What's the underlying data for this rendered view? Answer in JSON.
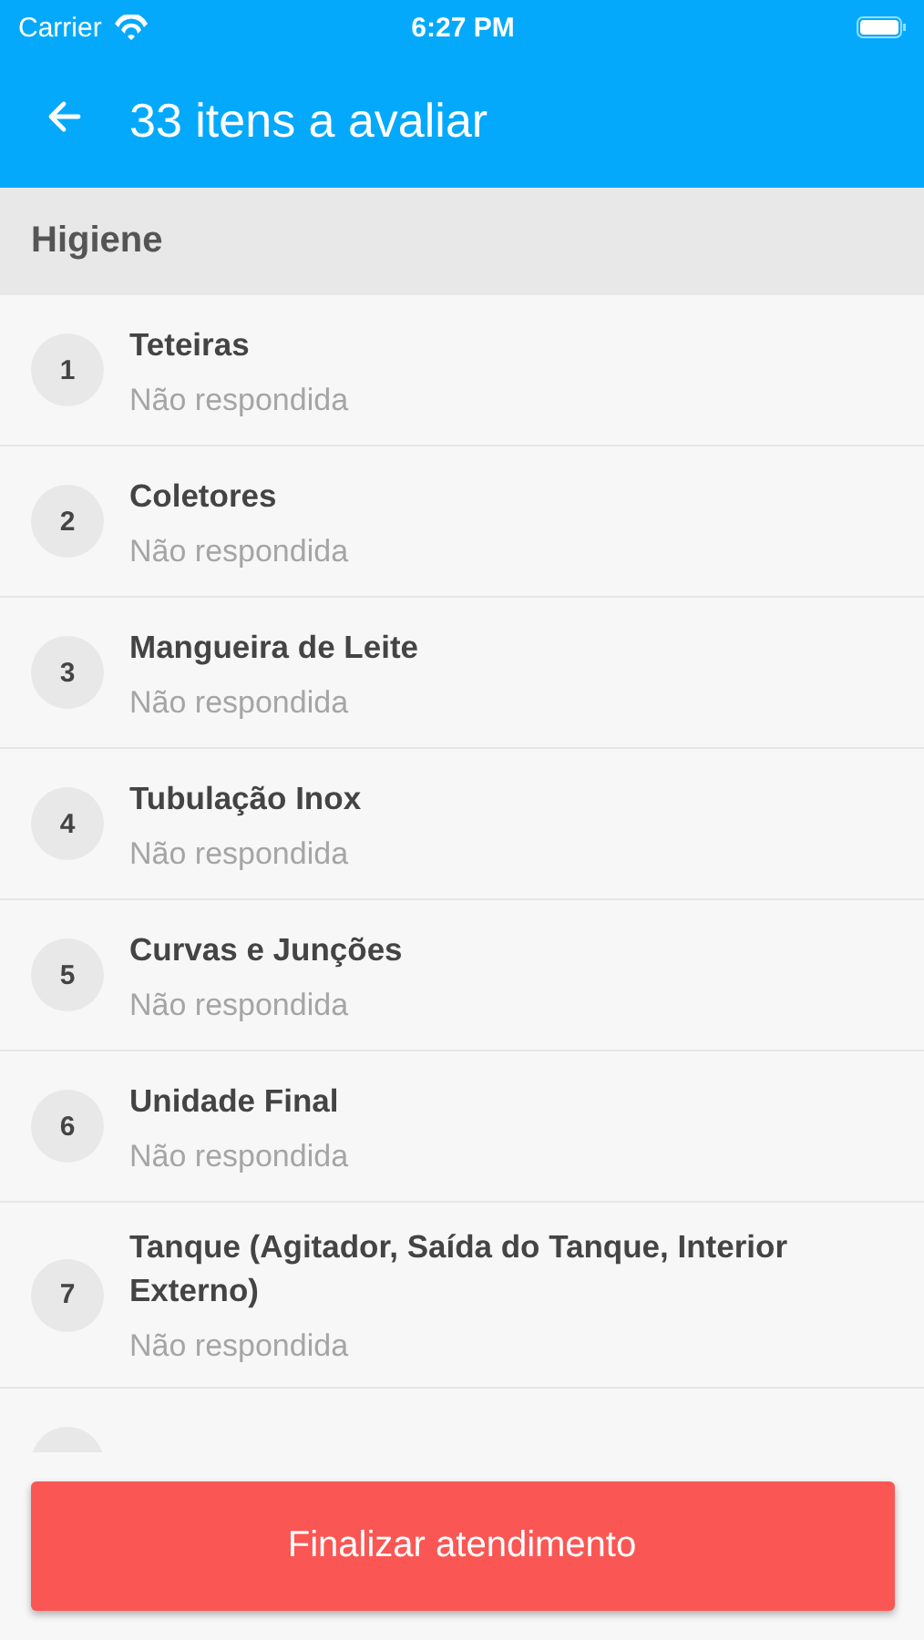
{
  "status_bar": {
    "carrier": "Carrier",
    "time": "6:27 PM"
  },
  "app_bar": {
    "title": "33 itens a avaliar"
  },
  "section": {
    "title": "Higiene"
  },
  "items": [
    {
      "number": "1",
      "title": "Teteiras",
      "status": "Não respondida"
    },
    {
      "number": "2",
      "title": "Coletores",
      "status": "Não respondida"
    },
    {
      "number": "3",
      "title": "Mangueira de Leite",
      "status": "Não respondida"
    },
    {
      "number": "4",
      "title": "Tubulação Inox",
      "status": "Não respondida"
    },
    {
      "number": "5",
      "title": "Curvas e Junções",
      "status": "Não respondida"
    },
    {
      "number": "6",
      "title": "Unidade Final",
      "status": "Não respondida"
    },
    {
      "number": "7",
      "title": "Tanque (Agitador, Saída do Tanque, Interior Externo)",
      "status": "Não respondida"
    }
  ],
  "more_below": true,
  "footer_button": "Finalizar atendimento"
}
